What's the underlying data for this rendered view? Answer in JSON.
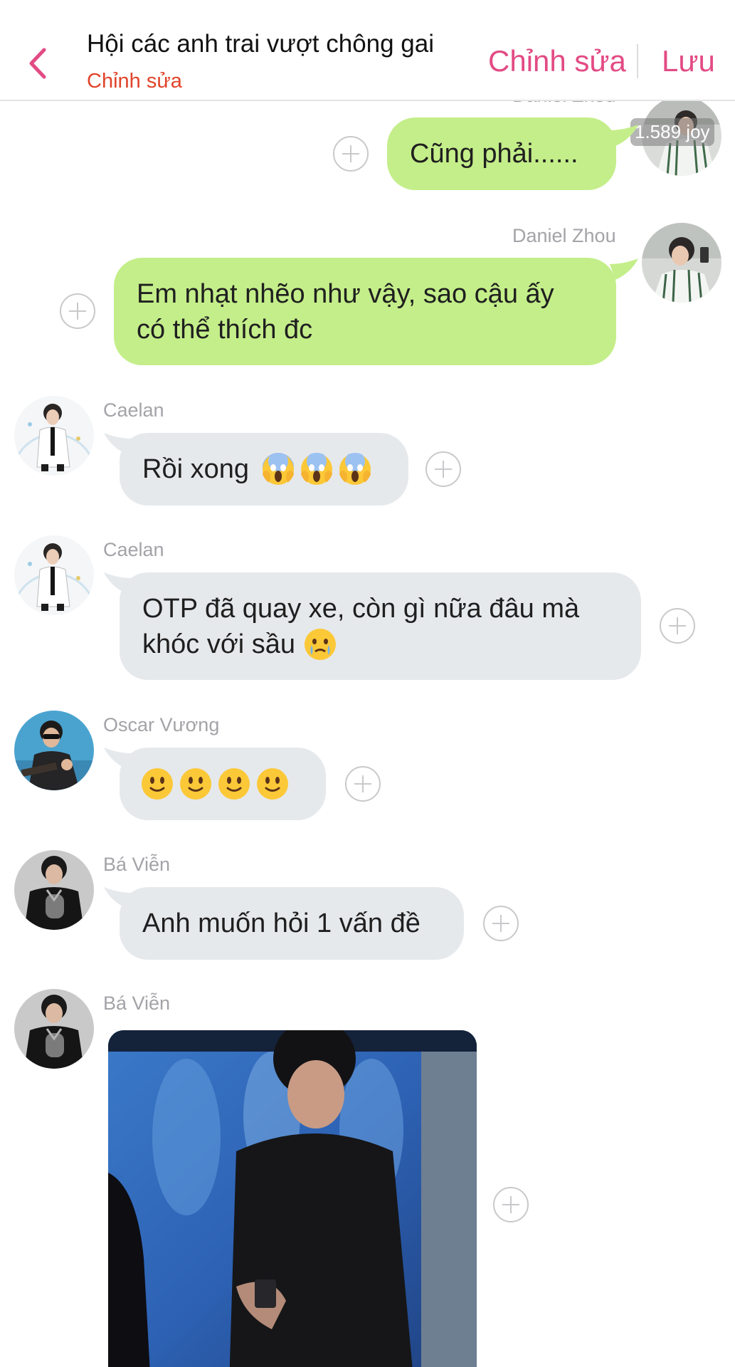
{
  "header": {
    "title": "Hội các anh trai vượt chông gai",
    "subtitle": "Chỉnh sửa",
    "edit_label": "Chỉnh sửa",
    "save_label": "Lưu",
    "back_icon": "chevron-left-icon",
    "accent_color": "#e24b84"
  },
  "messages": [
    {
      "sender": "Daniel Zhou",
      "text": "Cũng phải......",
      "direction": "out",
      "avatar_badge": "1.589 joy"
    },
    {
      "sender": "Daniel Zhou",
      "text_lines": [
        "Em nhạt nhẽo như vậy, sao cậu ấy",
        "có thể thích đc"
      ],
      "direction": "out"
    },
    {
      "sender": "Caelan",
      "text": "Rồi xong",
      "emojis": [
        "face-screaming-in-fear",
        "face-screaming-in-fear",
        "face-screaming-in-fear"
      ],
      "direction": "in"
    },
    {
      "sender": "Caelan",
      "text_lines": [
        "OTP đã quay xe, còn gì nữa đâu mà",
        "khóc với sầu"
      ],
      "emojis": [
        "face-holding-back-tears"
      ],
      "direction": "in"
    },
    {
      "sender": "Oscar Vương",
      "emojis": [
        "slightly-smiling-face",
        "slightly-smiling-face",
        "slightly-smiling-face",
        "slightly-smiling-face"
      ],
      "direction": "in"
    },
    {
      "sender": "Bá Viễn",
      "text": "Anh muốn hỏi 1 vấn đề",
      "direction": "in"
    },
    {
      "sender": "Bá Viễn",
      "attachment": "photo",
      "direction": "in"
    }
  ],
  "colors": {
    "outgoing_bubble": "#c4ee8a",
    "incoming_bubble": "#e6e9ec",
    "subtitle": "#e0442a"
  }
}
